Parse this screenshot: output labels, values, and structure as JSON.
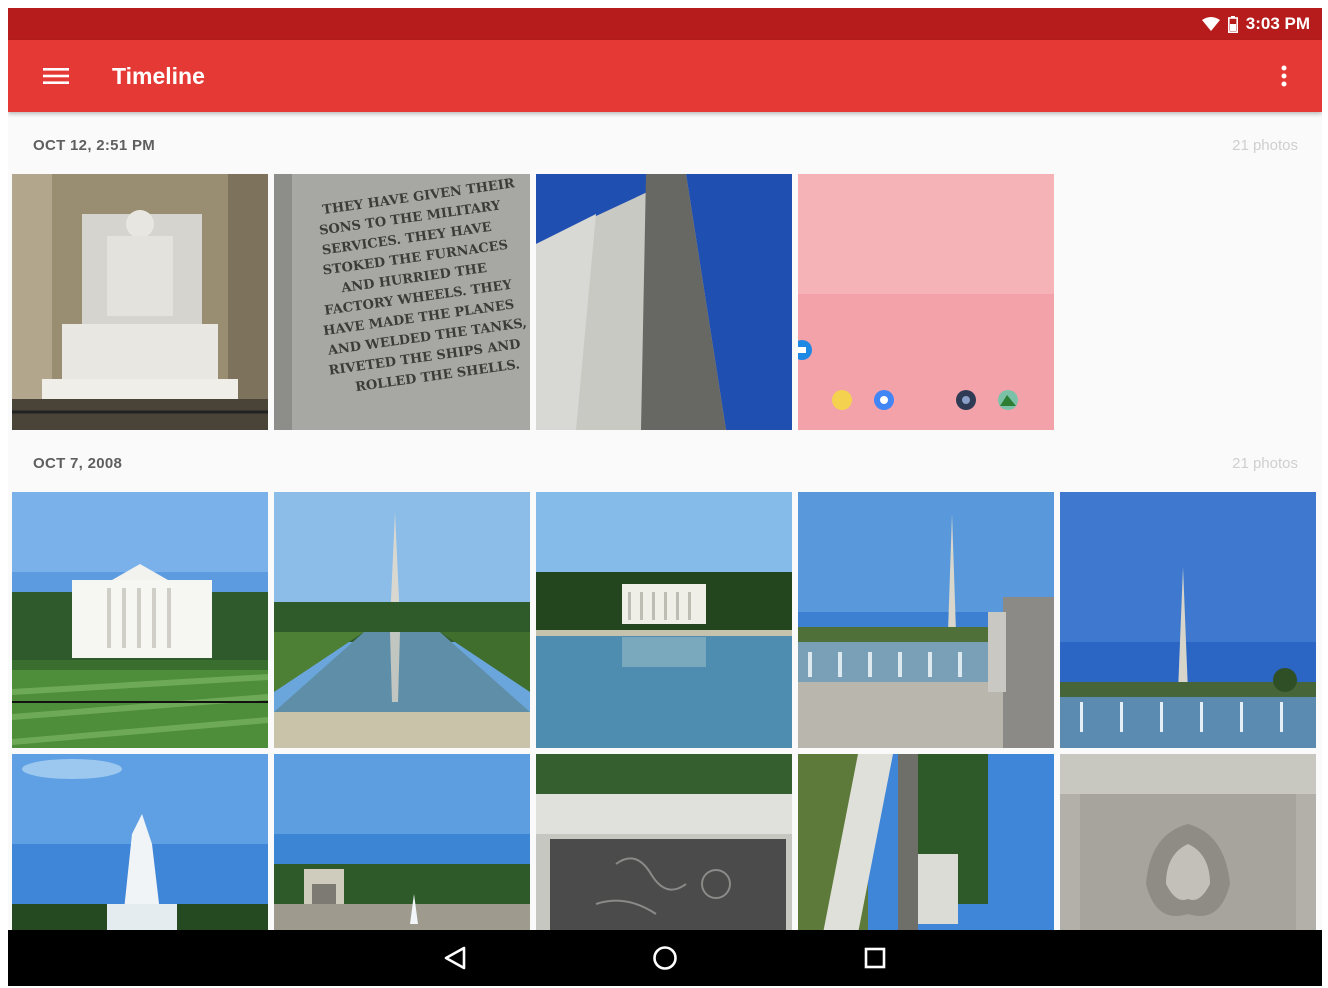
{
  "status_bar": {
    "time": "3:03 PM",
    "icons": [
      "wifi-icon",
      "battery-icon"
    ]
  },
  "app_bar": {
    "title": "Timeline",
    "menu_icon": "hamburger-menu-icon",
    "overflow_icon": "more-vert-icon",
    "color": "#e53935"
  },
  "sections": [
    {
      "date": "OCT 12, 2:51 PM",
      "count": "21 photos",
      "photos": [
        {
          "subject": "lincoln-statue"
        },
        {
          "subject": "memorial-inscription"
        },
        {
          "subject": "monument-closeup"
        },
        {
          "subject": "pink-screenshot"
        }
      ]
    },
    {
      "date": "OCT 7, 2008",
      "count": "21 photos",
      "photos": [
        {
          "subject": "white-house"
        },
        {
          "subject": "reflecting-pool-monument"
        },
        {
          "subject": "lincoln-memorial-pool"
        },
        {
          "subject": "wwii-memorial-monument"
        },
        {
          "subject": "monument-fountains"
        },
        {
          "subject": "fountain-jet"
        },
        {
          "subject": "wwii-memorial-pavilion"
        },
        {
          "subject": "stone-relief-panel"
        },
        {
          "subject": "walkway-sideways"
        },
        {
          "subject": "eagle-relief-pillar"
        }
      ]
    }
  ],
  "pink_screenshot": {
    "text": "",
    "icons": [
      "folder-icon",
      "chrome-icon",
      "camera-icon",
      "gallery-icon"
    ]
  },
  "inscription": {
    "lines": [
      "THEY HAVE GIVEN THEIR",
      "SONS TO THE MILITARY",
      "SERVICES. THEY HAVE",
      "STOKED THE FURNACES",
      "AND HURRIED THE",
      "FACTORY WHEELS. THEY",
      "HAVE MADE THE PLANES",
      "AND WELDED THE TANKS,",
      "RIVETED THE SHIPS AND",
      "ROLLED THE SHELLS."
    ]
  },
  "nav_bar": {
    "icons": [
      "back-icon",
      "home-icon",
      "recents-icon"
    ]
  }
}
